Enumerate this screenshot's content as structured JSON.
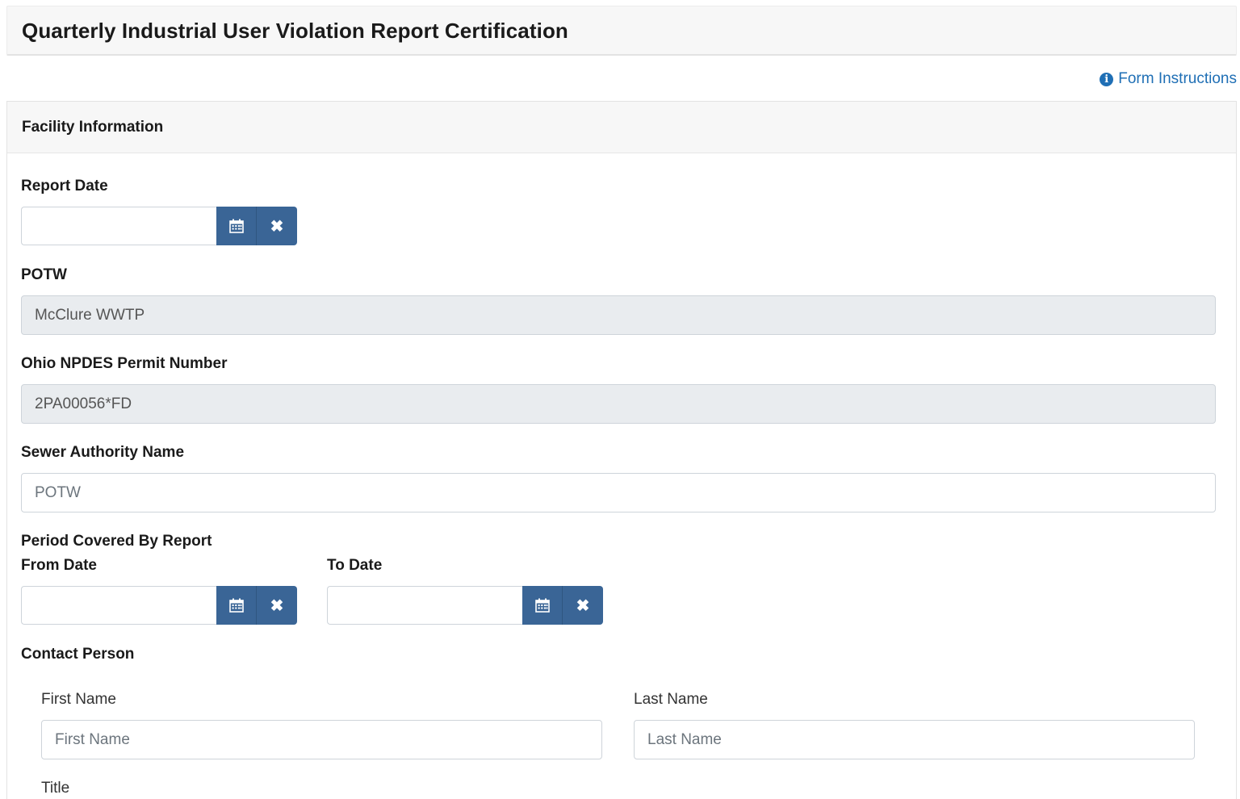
{
  "header": {
    "title": "Quarterly Industrial User Violation Report Certification"
  },
  "links": {
    "form_instructions": "Form Instructions"
  },
  "facility": {
    "section_title": "Facility Information",
    "report_date_label": "Report Date",
    "report_date_value": "",
    "potw_label": "POTW",
    "potw_value": "McClure WWTP",
    "permit_label": "Ohio NPDES Permit Number",
    "permit_value": "2PA00056*FD",
    "sewer_label": "Sewer Authority Name",
    "sewer_placeholder": "POTW",
    "period_label": "Period Covered By Report",
    "from_label": "From Date",
    "to_label": "To Date",
    "contact_label": "Contact Person",
    "first_name_label": "First Name",
    "first_name_placeholder": "First Name",
    "last_name_label": "Last Name",
    "last_name_placeholder": "Last Name",
    "title_label": "Title"
  },
  "icons": {
    "calendar": "calendar-icon",
    "clear": "close-icon",
    "clear_glyph": "✖",
    "info": "info-circle-icon",
    "info_glyph": "i"
  },
  "colors": {
    "button": "#3a6596",
    "link": "#1f6fb5",
    "readonly_bg": "#e9ecef"
  }
}
